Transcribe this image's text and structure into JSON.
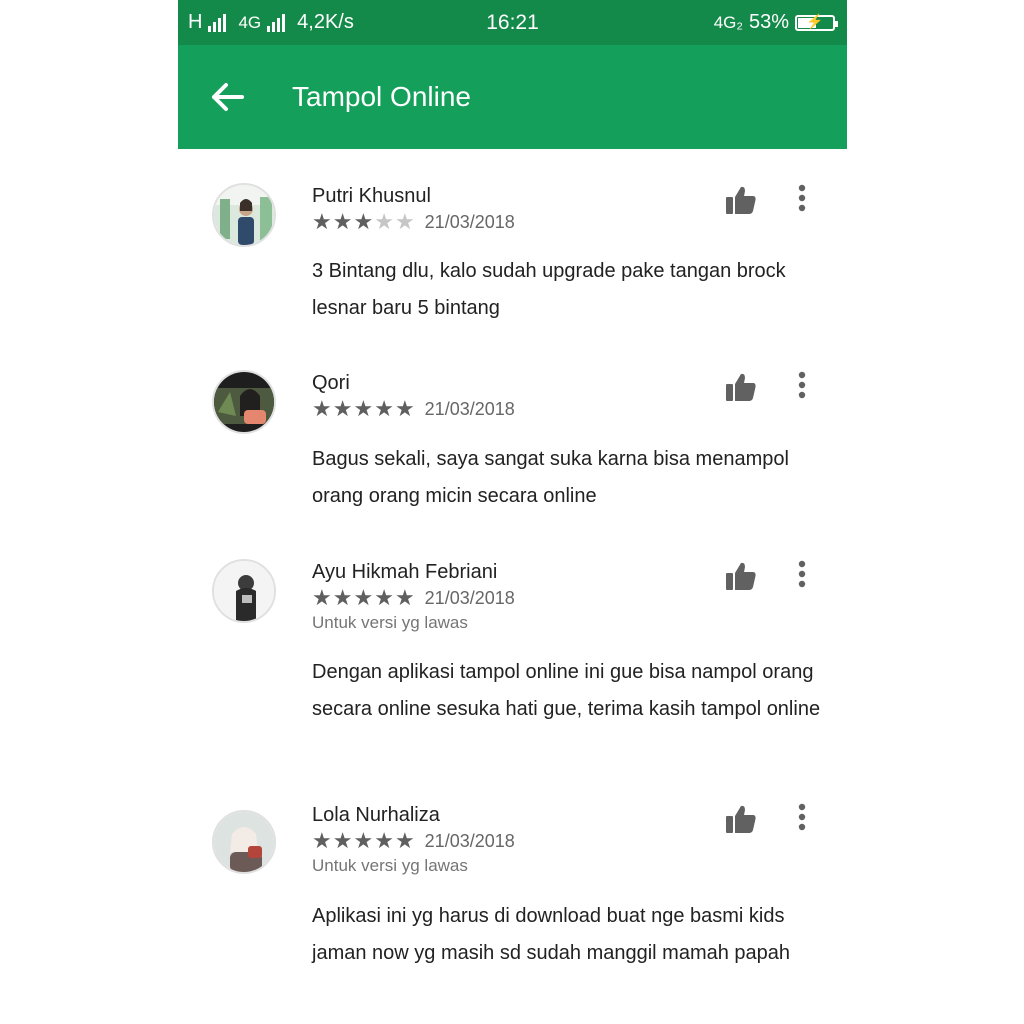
{
  "status_bar": {
    "network1": "H",
    "network2": "4G",
    "speed": "4,2K/s",
    "time": "16:21",
    "network3": "4G₂",
    "battery": "53%",
    "battery_level": 0.53,
    "colors": {
      "status_bg": "#148a4a"
    }
  },
  "app_bar": {
    "title": "Tampol Online",
    "back_icon": "arrow-left-icon",
    "colors": {
      "app_bar_bg": "#14a05a"
    }
  },
  "reviews": [
    {
      "author": "Putri Khusnul",
      "rating": 3,
      "max_rating": 5,
      "date": "21/03/2018",
      "version_note": "",
      "text": "3 Bintang dlu, kalo sudah upgrade pake tangan brock lesnar baru 5 bintang"
    },
    {
      "author": "Qori",
      "rating": 5,
      "max_rating": 5,
      "date": "21/03/2018",
      "version_note": "",
      "text": "Bagus sekali, saya sangat suka karna bisa menampol orang orang micin secara online"
    },
    {
      "author": "Ayu Hikmah Febriani",
      "rating": 5,
      "max_rating": 5,
      "date": "21/03/2018",
      "version_note": "Untuk versi yg lawas",
      "text": "Dengan aplikasi tampol online ini gue bisa nampol orang secara online sesuka hati gue, terima kasih tampol online"
    },
    {
      "author": "Lola Nurhaliza",
      "rating": 5,
      "max_rating": 5,
      "date": "21/03/2018",
      "version_note": "Untuk versi yg lawas",
      "text": "Aplikasi ini yg harus di download buat nge basmi kids jaman now yg masih sd sudah manggil mamah papah"
    }
  ],
  "icons": {
    "helpful": "thumbs-up-icon",
    "more": "more-vert-icon"
  }
}
